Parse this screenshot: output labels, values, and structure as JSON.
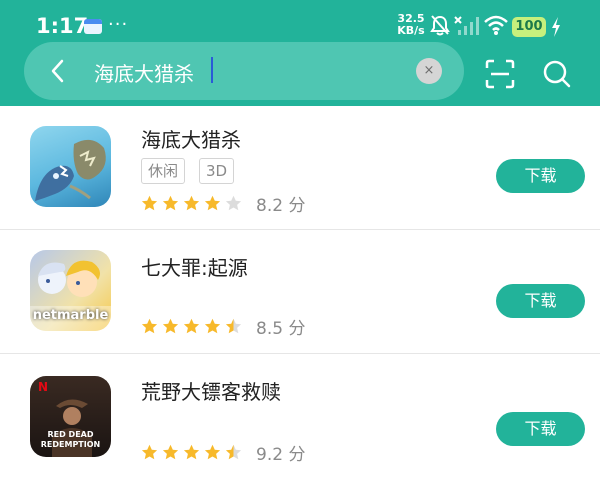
{
  "status_bar": {
    "time": "1:17",
    "net_speed_value": "32.5",
    "net_speed_unit": "KB/s",
    "battery": "100",
    "icons": [
      "notification-app-icon",
      "more-dots",
      "mute-bell-icon",
      "no-signal-icon",
      "wifi-icon",
      "cell-signal-icon",
      "battery-icon",
      "charging-icon"
    ]
  },
  "search": {
    "query": "海底大猎杀",
    "clear_label": "×"
  },
  "results": [
    {
      "name": "海底大猎杀",
      "tags": [
        "休闲",
        "3D"
      ],
      "rating": 4,
      "score": "8.2 分",
      "button": "下载",
      "icon": "sea-monster-game-icon"
    },
    {
      "name": "七大罪:起源",
      "tags": [],
      "rating": 4.5,
      "score": "8.5 分",
      "button": "下载",
      "icon": "anime-characters-icon",
      "icon_text": "netmarble"
    },
    {
      "name": "荒野大镖客救赎",
      "tags": [],
      "rating": 4.5,
      "score": "9.2 分",
      "button": "下载",
      "icon": "cowboy-game-icon",
      "icon_text_top": "RED DEAD",
      "icon_text_bottom": "REDEMPTION",
      "icon_badge": "N"
    }
  ],
  "colors": {
    "accent": "#22b39a",
    "search_bg": "#4fc6b2",
    "star": "#f7b92b",
    "star_empty": "#dcdcdc"
  }
}
